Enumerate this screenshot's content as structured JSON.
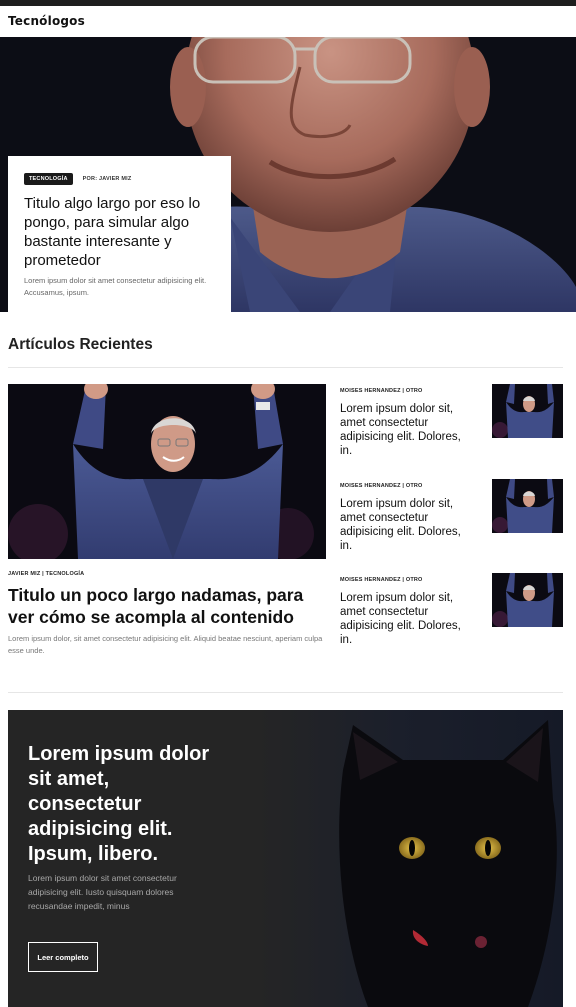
{
  "nav": {
    "brand": "Tecnólogos"
  },
  "hero": {
    "tag": "TECNOLOGÍA",
    "byline": "POR: JAVIER MIZ",
    "title": "Titulo algo largo por eso lo pongo, para simular algo bastante interesante y prometedor",
    "excerpt": "Lorem ipsum dolor sit amet consectetur adipisicing elit. Accusamus, ipsum."
  },
  "recent": {
    "heading": "Artículos Recientes",
    "featured": {
      "meta": "JAVIER MIZ | TECNOLOGÍA",
      "title": "Titulo un poco largo nadamas, para ver cómo se acompla al contenido",
      "excerpt": "Lorem ipsum dolor, sit amet consectetur adipisicing elit. Aliquid beatae nesciunt, aperiam culpa esse unde."
    },
    "items": [
      {
        "meta": "MOISES HERNANDEZ | OTRO",
        "title": "Lorem ipsum dolor sit, amet consectetur adipisicing elit. Dolores, in."
      },
      {
        "meta": "MOISES HERNANDEZ | OTRO",
        "title": "Lorem ipsum dolor sit, amet consectetur adipisicing elit. Dolores, in."
      },
      {
        "meta": "MOISES HERNANDEZ | OTRO",
        "title": "Lorem ipsum dolor sit, amet consectetur adipisicing elit. Dolores, in."
      }
    ]
  },
  "banner": {
    "title": "Lorem ipsum dolor sit amet, consectetur adipisicing elit. Ipsum, libero.",
    "text": "Lorem ipsum dolor sit amet consectetur adipisicing elit. Iusto quisquam dolores recusandae impedit, minus",
    "button": "Leer completo"
  }
}
